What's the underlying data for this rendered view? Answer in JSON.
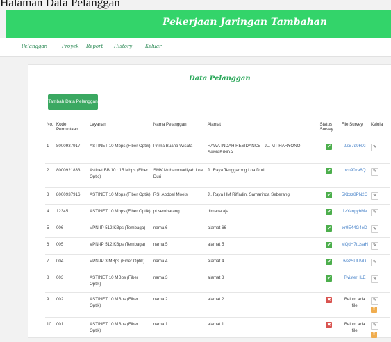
{
  "caption": "Halaman Data Pelanggan",
  "header": {
    "title": "Pekerjaan Jaringan Tambahan"
  },
  "nav": [
    {
      "label": "Pelanggan"
    },
    {
      "label": "Proyek"
    },
    {
      "label": "Report"
    },
    {
      "label": "History"
    },
    {
      "label": "Keluar"
    }
  ],
  "main": {
    "title": "Data Pelanggan",
    "add_button": "Tambah Data Pelanggan",
    "columns": [
      "No.",
      "Kode Permintaan",
      "Layanan",
      "Nama Pelanggan",
      "Alamat",
      "Status Survey",
      "File Survey",
      "Kelola"
    ],
    "rows": [
      {
        "no": "1",
        "kode": "8000937917",
        "layanan": "ASTINET 10 Mbps (Fiber Optik)",
        "nama": "Prima Buana Wisata",
        "alamat": "RAWA INDAH RESIDANCE - JL. MT HARYONO SAMARINDA",
        "status": "ok",
        "file": "2ZB7d9HXi",
        "upload": false
      },
      {
        "no": "2",
        "kode": "8000921833",
        "layanan": "Astinet BB 10 : 15 Mbps (Fiber Optic)",
        "nama": "SMK Muhammadiyah Loa Duri",
        "alamat": "Jl. Raya Tenggarong Loa Duri",
        "status": "ok",
        "file": "ocn90za6Q",
        "upload": false
      },
      {
        "no": "3",
        "kode": "8000937916",
        "layanan": "ASTINET 10 Mbps (Fiber Optik)",
        "nama": "RSI Abdoel Moeis",
        "alamat": "Jl. Raya HM Riffadin, Samarinda Seberang",
        "status": "ok",
        "file": "5Kbzz8PN2O",
        "upload": false
      },
      {
        "no": "4",
        "kode": "12345",
        "layanan": "ASTINET 10 Mbps (Fiber Optik)",
        "nama": "pt sembarang",
        "alamat": "dimana aja",
        "status": "ok",
        "file": "1zYanpybMv",
        "upload": false
      },
      {
        "no": "5",
        "kode": "006",
        "layanan": "VPN-IP 512 KBps (Tembaga)",
        "nama": "nama 6",
        "alamat": "alamat 66",
        "status": "ok",
        "file": "xr9E44G4eD",
        "upload": false
      },
      {
        "no": "6",
        "kode": "005",
        "layanan": "VPN-IP 512 KBps (Tembaga)",
        "nama": "nama 5",
        "alamat": "alamat 5",
        "status": "ok",
        "file": "MQdH7tUsaH",
        "upload": false
      },
      {
        "no": "7",
        "kode": "004",
        "layanan": "VPN-IP 3 MBps (Fiber Optik)",
        "nama": "nama 4",
        "alamat": "alamat 4",
        "status": "ok",
        "file": "wezSUIJVD",
        "upload": false
      },
      {
        "no": "8",
        "kode": "003",
        "layanan": "ASTINET 10 MBps (Fiber Optik)",
        "nama": "nama 3",
        "alamat": "alamat 3",
        "status": "ok",
        "file": "TwisterHLE",
        "upload": false
      },
      {
        "no": "9",
        "kode": "002",
        "layanan": "ASTINET 10 MBps (Fiber Optik)",
        "nama": "nama 2",
        "alamat": "alamat 2",
        "status": "bad",
        "file": "Belum ada file",
        "upload": true
      },
      {
        "no": "10",
        "kode": "001",
        "layanan": "ASTINET 10 MBps (Fiber Optik)",
        "nama": "nama 1",
        "alamat": "alamat 1",
        "status": "bad",
        "file": "Belum ada file",
        "upload": true
      }
    ]
  },
  "icons": {
    "status_ok": "check-icon",
    "status_bad": "x-icon",
    "edit": "pencil-icon",
    "upload": "upload-icon"
  },
  "colors": {
    "header": "#33d46a",
    "button": "#3aa861",
    "link": "#4a84c9",
    "ok": "#4cae4c",
    "bad": "#d9534f",
    "upload": "#f0ad4e"
  }
}
